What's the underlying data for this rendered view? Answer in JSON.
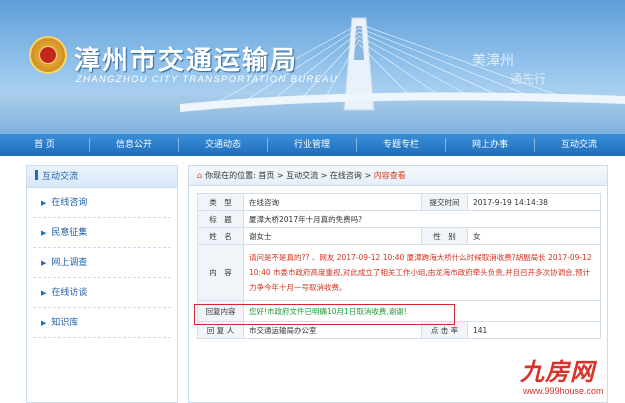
{
  "banner": {
    "title": "漳州市交通运输局",
    "subtitle": "ZHANGZHOU CITY TRANSPORTATION BUREAU",
    "slogan1": "美漳州",
    "slogan2": "通先行"
  },
  "nav": {
    "items": [
      "首 页",
      "信息公开",
      "交通动态",
      "行业管理",
      "专题专栏",
      "网上办事",
      "互动交流"
    ]
  },
  "sidebar": {
    "header": "互动交流",
    "items": [
      "在线咨询",
      "民意征集",
      "网上调查",
      "在线访谈",
      "知识库"
    ]
  },
  "breadcrumb": {
    "prefix": "你现在的位置:",
    "home": "首页",
    "sep": ">",
    "level1": "互动交流",
    "level2": "在线咨询",
    "current": "内容查看"
  },
  "detail": {
    "type_label": "类　型",
    "type_value": "在线咨询",
    "time_label": "提交时间",
    "time_value": "2017-9-19 14:14:38",
    "title_label": "标　题",
    "title_value": "厦漳大桥2017年十月真的免费吗?",
    "name_label": "姓　名",
    "name_value": "谢女士",
    "gender_label": "性　别",
    "gender_value": "女",
    "content_label": "内　容",
    "content_value": "请问是不是真的?? 、网友 2017-09-12 10:40 厦漳跨海大桥什么时候取消收费?胡副局长 2017-09-12 10:40 市委市政府高度重视,对此成立了相关工作小组,由龙海市政府牵头负责,并且召开多次协调会,预计力争今年十月一号取消收费。",
    "reply_label": "回复内容",
    "reply_value": "您好!市政府文件已明确10月1日取消收费,谢谢!",
    "replier_label": "回 复 人",
    "replier_value": "市交通运输局办公室",
    "clicks_label": "点 击 率",
    "clicks_value": "141"
  },
  "watermark": {
    "brand": "九房网",
    "url": "www.999house.com"
  },
  "colors": {
    "nav": "#1f6dbc",
    "accent_red": "#d8301e",
    "reply_green": "#1c9a3a"
  }
}
